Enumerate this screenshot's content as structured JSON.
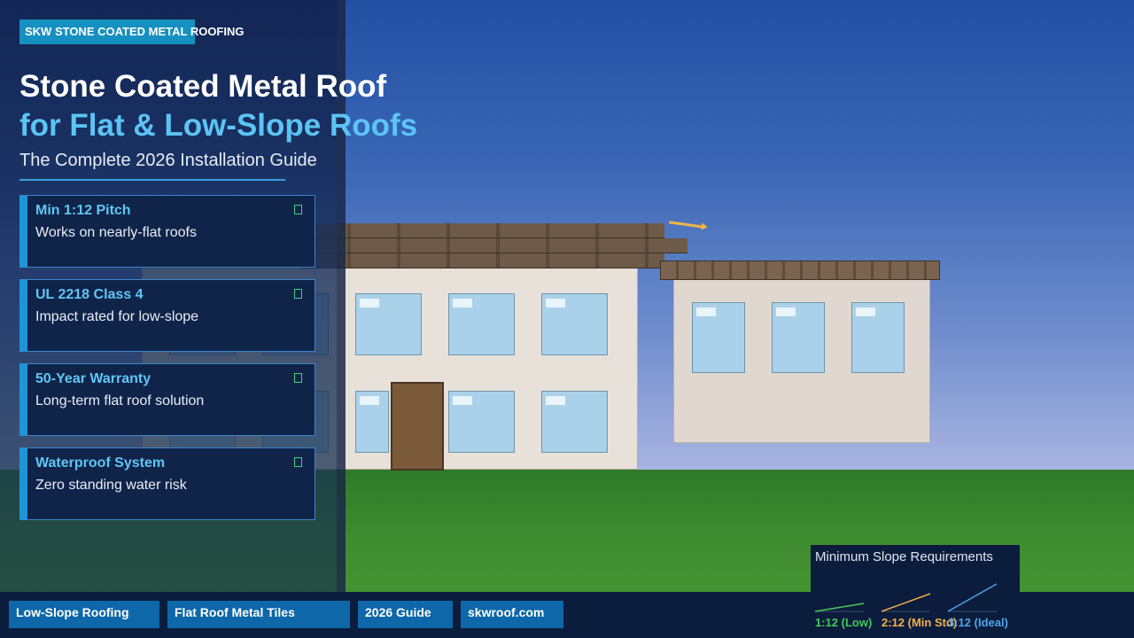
{
  "brand": "SKW STONE COATED METAL ROOFING",
  "title_line1": "Stone Coated Metal Roof",
  "title_line2": "for Flat & Low-Slope Roofs",
  "subtitle": "The Complete 2026 Installation Guide",
  "features": [
    {
      "title": "Min 1:12 Pitch",
      "description": "Works on nearly-flat roofs",
      "icon": "check-icon"
    },
    {
      "title": "UL 2218 Class 4",
      "description": "Impact rated for low-slope",
      "icon": "check-icon"
    },
    {
      "title": "50-Year Warranty",
      "description": "Long-term flat roof solution",
      "icon": "check-icon"
    },
    {
      "title": "Waterproof System",
      "description": "Zero standing water risk",
      "icon": "check-icon"
    }
  ],
  "tags": [
    "Low-Slope Roofing",
    "Flat Roof Metal Tiles",
    "2026 Guide",
    "skwroof.com"
  ],
  "slope_panel": {
    "title": "Minimum Slope Requirements",
    "items": [
      {
        "label": "1:12 (Low)",
        "color": "#44c95a"
      },
      {
        "label": "2:12 (Min Std)",
        "color": "#f3b04a"
      },
      {
        "label": "3:12 (Ideal)",
        "color": "#4ea6e8"
      }
    ]
  },
  "colors": {
    "accent": "#1f95d8",
    "heading_accent": "#5cc4f5",
    "panel": "#10244a"
  }
}
